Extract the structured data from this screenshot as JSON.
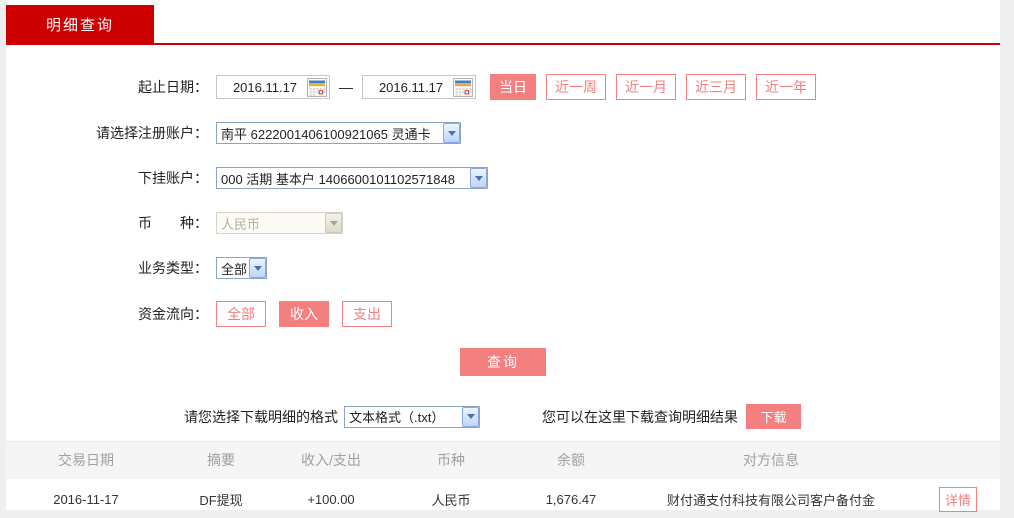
{
  "colors": {
    "brand_red": "#cc0001",
    "salmon": "#f47f7f",
    "amount_red": "#e60012"
  },
  "tab": {
    "label": "明细查询"
  },
  "form": {
    "date": {
      "label": "起止日期：",
      "start": "2016.11.17",
      "end": "2016.11.17",
      "separator": "—"
    },
    "quick_ranges": [
      {
        "label": "当日",
        "active": true
      },
      {
        "label": "近一周",
        "active": false
      },
      {
        "label": "近一月",
        "active": false
      },
      {
        "label": "近三月",
        "active": false
      },
      {
        "label": "近一年",
        "active": false
      }
    ],
    "register_account": {
      "label": "请选择注册账户：",
      "value": "南平  6222001406100921065  灵通卡"
    },
    "sub_account": {
      "label": "下挂账户：",
      "value": "000  活期  基本户  1406600101102571848"
    },
    "currency": {
      "label": "币　　种：",
      "value": "人民币",
      "disabled": true
    },
    "business_type": {
      "label": "业务类型：",
      "value": "全部"
    },
    "fund_flow": {
      "label": "资金流向：",
      "options": [
        {
          "label": "全部",
          "active": false
        },
        {
          "label": "收入",
          "active": true
        },
        {
          "label": "支出",
          "active": false
        }
      ]
    },
    "query_button": "查询"
  },
  "download": {
    "format_label": "请您选择下载明细的格式",
    "format_value": "文本格式（.txt）",
    "hint": "您可以在这里下载查询明细结果",
    "button_label": "下载"
  },
  "table": {
    "headers": [
      "交易日期",
      "摘要",
      "收入/支出",
      "币种",
      "余额",
      "对方信息"
    ],
    "rows": [
      {
        "date": "2016-11-17",
        "summary": "DF提现",
        "amount": "+100.00",
        "currency": "人民币",
        "balance": "1,676.47",
        "counterparty": "财付通支付科技有限公司客户备付金",
        "action": "详情"
      }
    ]
  }
}
